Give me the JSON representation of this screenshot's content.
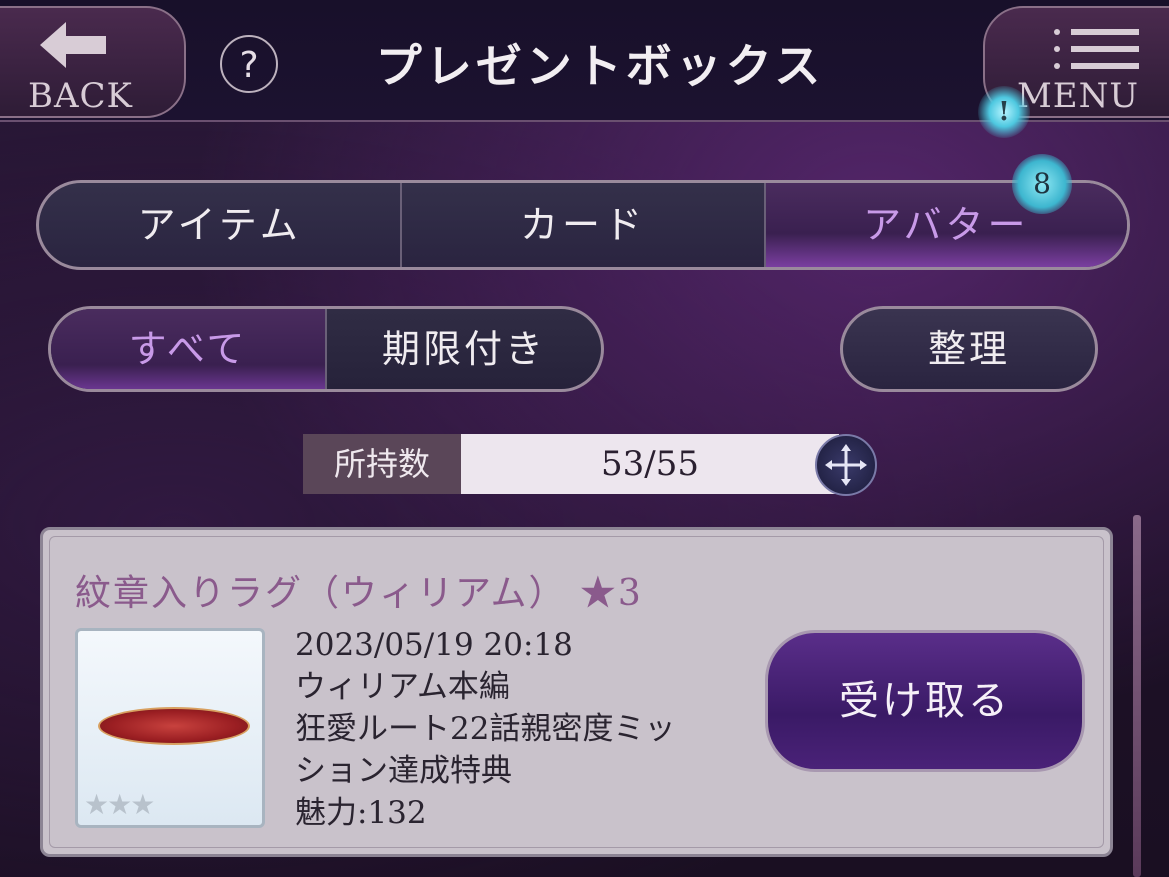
{
  "header": {
    "back_label": "BACK",
    "help_label": "?",
    "title": "プレゼントボックス",
    "menu_label": "MENU",
    "alert_badge": "!"
  },
  "tabs": [
    {
      "label": "アイテム",
      "active": false
    },
    {
      "label": "カード",
      "active": false
    },
    {
      "label": "アバター",
      "active": true
    }
  ],
  "tab_badge": "8",
  "filters": [
    {
      "label": "すべて",
      "active": true
    },
    {
      "label": "期限付き",
      "active": false
    }
  ],
  "organize_label": "整理",
  "count": {
    "label": "所持数",
    "value": "53/55"
  },
  "item": {
    "name": "紋章入りラグ（ウィリアム） ★3",
    "stars": "★★★",
    "lines": [
      "2023/05/19 20:18",
      "ウィリアム本編",
      "狂愛ルート22話親密度ミッ",
      "ション達成特典",
      "魅力:132"
    ],
    "receive_label": "受け取る"
  },
  "colors": {
    "accent_purple": "#c89ae8",
    "badge_cyan": "#3db6cf"
  }
}
